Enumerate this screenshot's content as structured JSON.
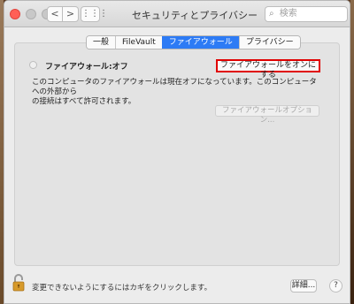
{
  "window": {
    "title": "セキュリティとプライバシー"
  },
  "toolbar": {
    "back_label": "<",
    "forward_label": ">",
    "grid_label": "⋮⋮⋮",
    "search_icon": "⌕",
    "search_placeholder": "検索"
  },
  "tabs": [
    {
      "label": "一般",
      "active": false
    },
    {
      "label": "FileVault",
      "active": false
    },
    {
      "label": "ファイアウォール",
      "active": true
    },
    {
      "label": "プライバシー",
      "active": false
    }
  ],
  "firewall": {
    "status_label": "ファイアウォール:オフ",
    "turn_on_button": "ファイアウォールをオンにする",
    "description_line1": "このコンピュータのファイアウォールは現在オフになっています。このコンピュータへの外部から",
    "description_line2": "の接続はすべて許可されます。",
    "options_button": "ファイアウォールオプション..."
  },
  "footer": {
    "lock_text": "変更できないようにするにはカギをクリックします。",
    "details_button": "詳細...",
    "help_button": "?"
  },
  "colors": {
    "accent": "#2d7bf5",
    "highlight_border": "#e00000",
    "close": "#ff5f57",
    "lock": "#d79a2a"
  }
}
